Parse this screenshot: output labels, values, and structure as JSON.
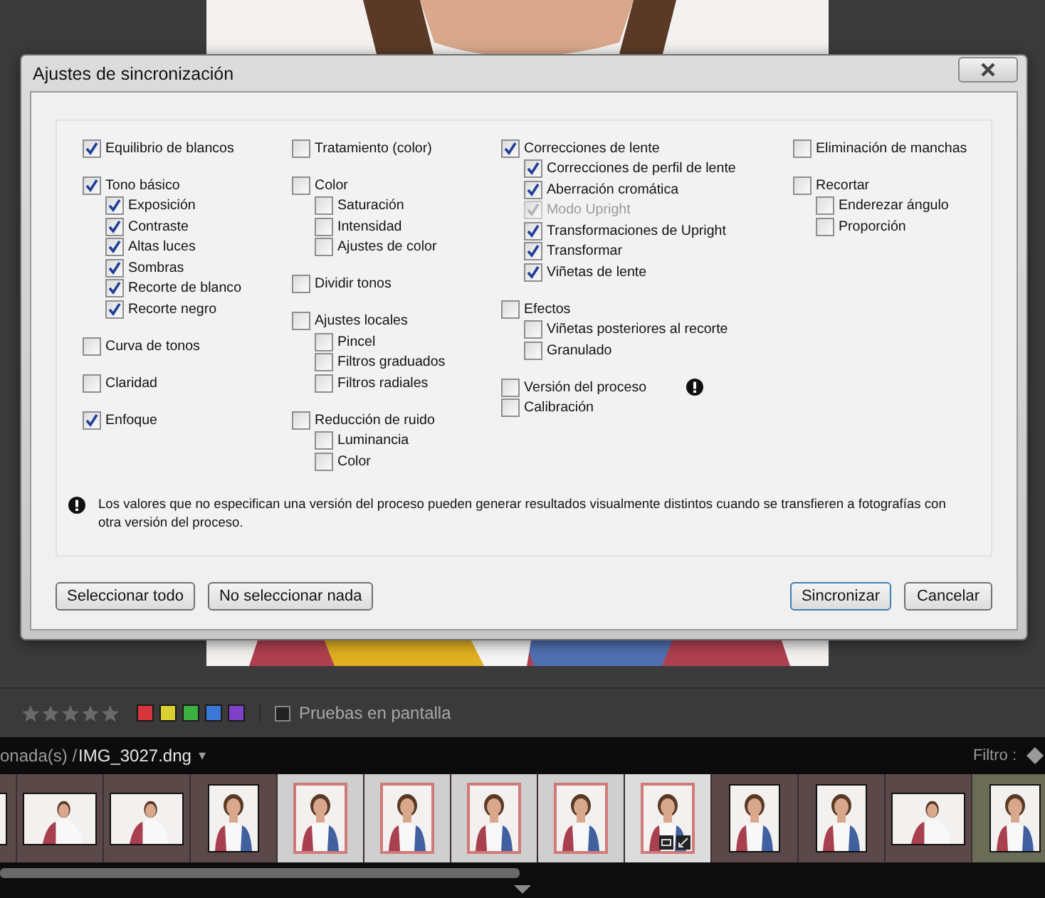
{
  "dialog": {
    "title": "Ajustes de sincronización",
    "columns": [
      {
        "sections": [
          [
            {
              "label": "Equilibrio de blancos",
              "checked": true,
              "warning": false
            }
          ],
          [
            {
              "label": "Tono básico",
              "checked": true,
              "warning": false,
              "children": [
                {
                  "label": "Exposición",
                  "checked": true,
                  "disabled": false
                },
                {
                  "label": "Contraste",
                  "checked": true,
                  "disabled": false
                },
                {
                  "label": "Altas luces",
                  "checked": true,
                  "disabled": false
                },
                {
                  "label": "Sombras",
                  "checked": true,
                  "disabled": false
                },
                {
                  "label": "Recorte de blanco",
                  "checked": true,
                  "disabled": false
                },
                {
                  "label": "Recorte negro",
                  "checked": true,
                  "disabled": false
                }
              ]
            }
          ],
          [
            {
              "label": "Curva de tonos",
              "checked": false,
              "warning": false
            }
          ],
          [
            {
              "label": "Claridad",
              "checked": false,
              "warning": false
            }
          ],
          [
            {
              "label": "Enfoque",
              "checked": true,
              "warning": false
            }
          ]
        ]
      },
      {
        "sections": [
          [
            {
              "label": "Tratamiento (color)",
              "checked": false,
              "warning": false
            }
          ],
          [
            {
              "label": "Color",
              "checked": false,
              "warning": false,
              "children": [
                {
                  "label": "Saturación",
                  "checked": false,
                  "disabled": false
                },
                {
                  "label": "Intensidad",
                  "checked": false,
                  "disabled": false
                },
                {
                  "label": "Ajustes de color",
                  "checked": false,
                  "disabled": false
                }
              ]
            }
          ],
          [
            {
              "label": "Dividir tonos",
              "checked": false,
              "warning": false
            }
          ],
          [
            {
              "label": "Ajustes locales",
              "checked": false,
              "warning": false,
              "children": [
                {
                  "label": "Pincel",
                  "checked": false,
                  "disabled": false
                },
                {
                  "label": "Filtros graduados",
                  "checked": false,
                  "disabled": false
                },
                {
                  "label": "Filtros radiales",
                  "checked": false,
                  "disabled": false
                }
              ]
            }
          ],
          [
            {
              "label": "Reducción de ruido",
              "checked": false,
              "warning": false,
              "children": [
                {
                  "label": "Luminancia",
                  "checked": false,
                  "disabled": false
                },
                {
                  "label": "Color",
                  "checked": false,
                  "disabled": false
                }
              ]
            }
          ]
        ]
      },
      {
        "sections": [
          [
            {
              "label": "Correcciones de lente",
              "checked": true,
              "warning": false,
              "children": [
                {
                  "label": "Correcciones de perfil de lente",
                  "checked": true,
                  "disabled": false
                },
                {
                  "label": "Aberración cromática",
                  "checked": true,
                  "disabled": false
                },
                {
                  "label": "Modo Upright",
                  "checked": true,
                  "disabled": true
                },
                {
                  "label": "Transformaciones de Upright",
                  "checked": true,
                  "disabled": false
                },
                {
                  "label": "Transformar",
                  "checked": true,
                  "disabled": false
                },
                {
                  "label": "Viñetas de lente",
                  "checked": true,
                  "disabled": false
                }
              ]
            }
          ],
          [
            {
              "label": "Efectos",
              "checked": false,
              "warning": false,
              "children": [
                {
                  "label": "Viñetas posteriores al recorte",
                  "checked": false,
                  "disabled": false
                },
                {
                  "label": "Granulado",
                  "checked": false,
                  "disabled": false
                }
              ]
            }
          ],
          [
            {
              "label": "Versión del proceso",
              "checked": false,
              "warning": true
            },
            {
              "label": "Calibración",
              "checked": false,
              "warning": false
            }
          ]
        ]
      },
      {
        "sections": [
          [
            {
              "label": "Eliminación de manchas",
              "checked": false,
              "warning": false
            }
          ],
          [
            {
              "label": "Recortar",
              "checked": false,
              "warning": false,
              "children": [
                {
                  "label": "Enderezar ángulo",
                  "checked": false,
                  "disabled": false
                },
                {
                  "label": "Proporción",
                  "checked": false,
                  "disabled": false
                }
              ]
            }
          ]
        ]
      }
    ],
    "note": "Los valores que no especifican una versión del proceso pueden generar resultados visualmente distintos cuando se transfieren a fotografías con otra versión del proceso.",
    "left_buttons": [
      "Seleccionar todo",
      "No seleccionar nada"
    ],
    "right_buttons": [
      "Sincronizar",
      "Cancelar"
    ]
  },
  "toolbar": {
    "stars": 0,
    "labels": [
      {
        "color": "#d8343c"
      },
      {
        "color": "#d8d030"
      },
      {
        "color": "#3cb040"
      },
      {
        "color": "#3c78d8"
      },
      {
        "color": "#8040c8"
      }
    ],
    "proof": {
      "label": "Pruebas en pantalla",
      "checked": false
    }
  },
  "path_bar": {
    "prefix": "onada(s) /",
    "file": "IMG_3027.dng",
    "caret": "▾",
    "filter_label": "Filtro :"
  },
  "filmstrip": [
    {
      "kind": "landscape",
      "selected": false,
      "color": "#5b4949",
      "edited": false
    },
    {
      "kind": "landscape",
      "selected": false,
      "color": "#5b4949",
      "edited": false
    },
    {
      "kind": "landscape",
      "selected": false,
      "color": "#5b4949",
      "edited": false
    },
    {
      "kind": "portrait",
      "selected": false,
      "color": "#5b4949",
      "edited": false
    },
    {
      "kind": "portrait",
      "selected": true,
      "color": "#cfcfcf",
      "edited": false
    },
    {
      "kind": "portrait",
      "selected": true,
      "color": "#cfcfcf",
      "edited": false
    },
    {
      "kind": "portrait",
      "selected": true,
      "color": "#cfcfcf",
      "edited": false
    },
    {
      "kind": "portrait",
      "selected": true,
      "color": "#cfcfcf",
      "edited": false
    },
    {
      "kind": "portrait",
      "selected": true,
      "color": "#dcdcdc",
      "edited": true
    },
    {
      "kind": "portrait",
      "selected": false,
      "color": "#5b4949",
      "edited": false
    },
    {
      "kind": "portrait",
      "selected": false,
      "color": "#5b4949",
      "edited": false
    },
    {
      "kind": "landscape",
      "selected": false,
      "color": "#5b4949",
      "edited": false
    },
    {
      "kind": "portrait",
      "selected": false,
      "color": "#6b6c55",
      "edited": false
    }
  ]
}
